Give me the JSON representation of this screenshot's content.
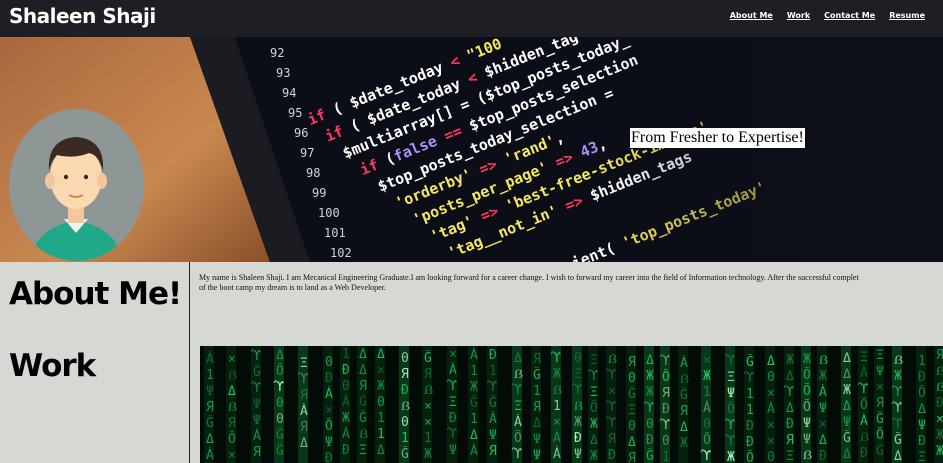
{
  "header": {
    "brand": "Shaleen Shaji",
    "nav": [
      {
        "label": "About Me"
      },
      {
        "label": "Work"
      },
      {
        "label": "Contact Me"
      },
      {
        "label": "Resume"
      }
    ]
  },
  "hero": {
    "tagline": "From Fresher to Expertise!"
  },
  "sidebar": {
    "about_heading": "About Me!",
    "work_heading": "Work"
  },
  "about": {
    "line1": "My name is Shaleen Shaji. I am Mecanical Engineering Graduate.I am looking forward for a career change. I wish to forward my career into the field of Information technology. After the successful complet",
    "line2": "of the boot camp my dream is to land as a Web Developer."
  },
  "colors": {
    "nav_bg": "#1e1f25",
    "page_bg": "#d5d8d3",
    "matrix_green": "#22c55e"
  }
}
